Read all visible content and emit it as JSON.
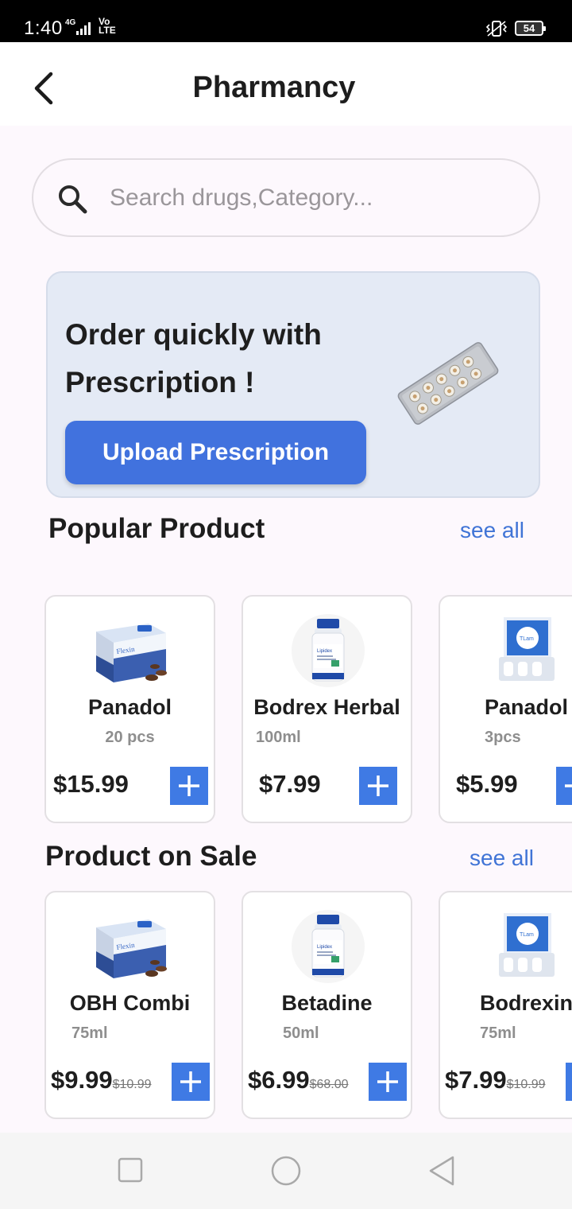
{
  "status_bar": {
    "time": "1:40",
    "network": "4G",
    "volte": "Vo\nLTE",
    "battery": "54"
  },
  "header": {
    "title": "Pharmancy",
    "back_icon": "chevron-left-icon"
  },
  "search": {
    "placeholder": "Search drugs,Category...",
    "icon": "search-icon"
  },
  "banner": {
    "title": "Order quickly with Prescription !",
    "button_label": "Upload Prescription",
    "background": "#e4eaf5",
    "accent": "#4172de"
  },
  "popular": {
    "title": "Popular Product",
    "see_all": "see all",
    "items": [
      {
        "name": "Panadol",
        "qty": "20 pcs",
        "price": "$15.99",
        "image": "blue-medicine-box"
      },
      {
        "name": "Bodrex Herbal",
        "qty": "100ml",
        "price": "$7.99",
        "image": "supplement-bottle"
      },
      {
        "name": "Panadol",
        "qty": "3pcs",
        "price": "$5.99",
        "image": "tablet-pack"
      }
    ]
  },
  "sale": {
    "title": "Product on Sale",
    "see_all": "see all",
    "items": [
      {
        "name": "OBH Combi",
        "qty": "75ml",
        "price": "$9.99",
        "old_price": "$10.99",
        "image": "blue-medicine-box"
      },
      {
        "name": "Betadine",
        "qty": "50ml",
        "price": "$6.99",
        "old_price": "$68.00",
        "image": "supplement-bottle"
      },
      {
        "name": "Bodrexin",
        "qty": "75ml",
        "price": "$7.99",
        "old_price": "$10.99",
        "image": "tablet-pack"
      }
    ]
  },
  "nav": {
    "recent": "square-icon",
    "home": "circle-icon",
    "back": "triangle-back-icon"
  }
}
